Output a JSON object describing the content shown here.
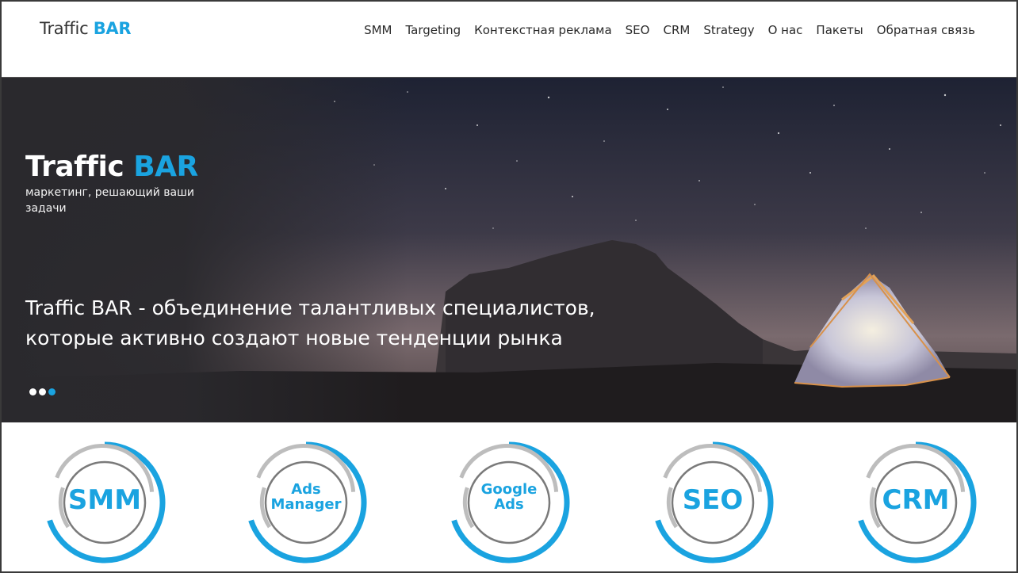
{
  "header": {
    "logo_text": "Traffic",
    "logo_accent": "BAR",
    "nav": [
      {
        "label": "SMM"
      },
      {
        "label": "Targeting"
      },
      {
        "label": "Контекстная реклама"
      },
      {
        "label": "SEO"
      },
      {
        "label": "CRM"
      },
      {
        "label": "Strategy"
      },
      {
        "label": "О нас"
      },
      {
        "label": "Пакеты"
      },
      {
        "label": "Обратная связь"
      }
    ]
  },
  "hero": {
    "title": "Traffic",
    "title_accent": "BAR",
    "subtitle": "маркетинг, решающий ваши задачи",
    "description": "Traffic BAR - объединение талантливых специалистов, которые активно создают новые тенденции рынка",
    "slides_count": 3,
    "active_slide": 3
  },
  "services": [
    {
      "line1": "SMM",
      "line2": ""
    },
    {
      "line1": "Ads",
      "line2": "Manager"
    },
    {
      "line1": "Google",
      "line2": "Ads"
    },
    {
      "line1": "SEO",
      "line2": ""
    },
    {
      "line1": "CRM",
      "line2": ""
    }
  ],
  "colors": {
    "accent": "#1aa3e0",
    "ring_gray": "#bdbdbd",
    "inner_gray": "#7a7a7a"
  }
}
